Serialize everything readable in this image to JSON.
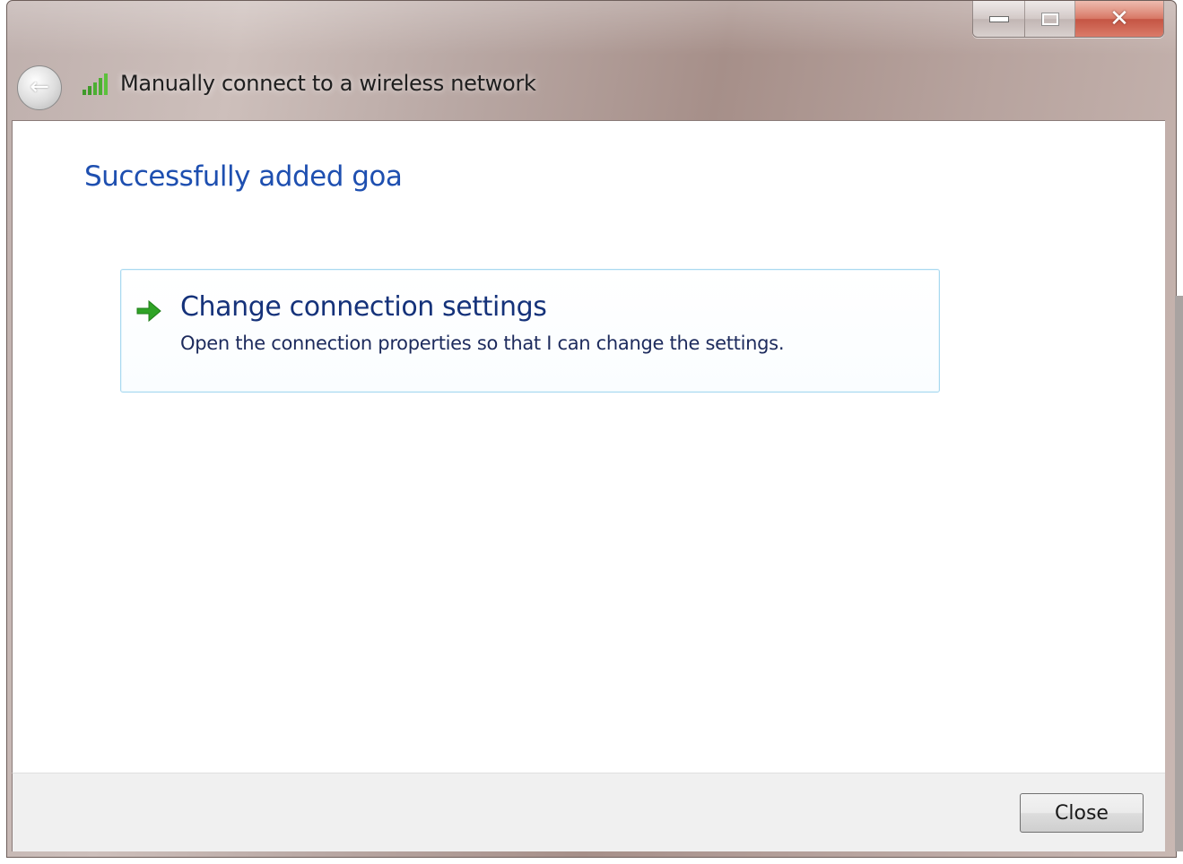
{
  "window": {
    "title": "Manually connect to a wireless network",
    "icons": {
      "back": "back-arrow-icon",
      "signal": "wireless-signal-icon",
      "minimize": "minimize-icon",
      "maximize": "maximize-icon",
      "close": "close-icon"
    }
  },
  "main": {
    "heading": "Successfully added goa",
    "command_link": {
      "icon": "green-arrow-icon",
      "title": "Change connection settings",
      "description": "Open the connection properties so that I can change the settings."
    }
  },
  "footer": {
    "close_label": "Close"
  },
  "colors": {
    "heading": "#1e4fb0",
    "link_title": "#15327a",
    "arrow": "#2fa326",
    "close_button_caption": "#c8452f"
  }
}
